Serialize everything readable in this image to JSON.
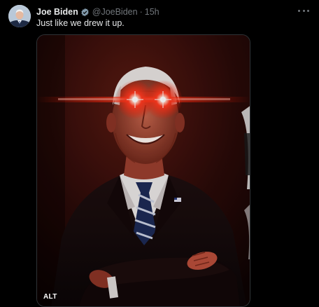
{
  "tweet": {
    "author_name": "Joe Biden",
    "author_handle": "@JoeBiden",
    "separator": "·",
    "timestamp": "15h",
    "text": "Just like we drew it up.",
    "alt_badge": "ALT"
  },
  "icons": {
    "verified": "verified-badge-icon",
    "more": "more-options-icon"
  },
  "colors": {
    "background": "#000000",
    "primary_text": "#e7e9ea",
    "secondary_text": "#71767b",
    "verified_badge": "#829aab",
    "laser_eyes": "#ff2a1a"
  }
}
